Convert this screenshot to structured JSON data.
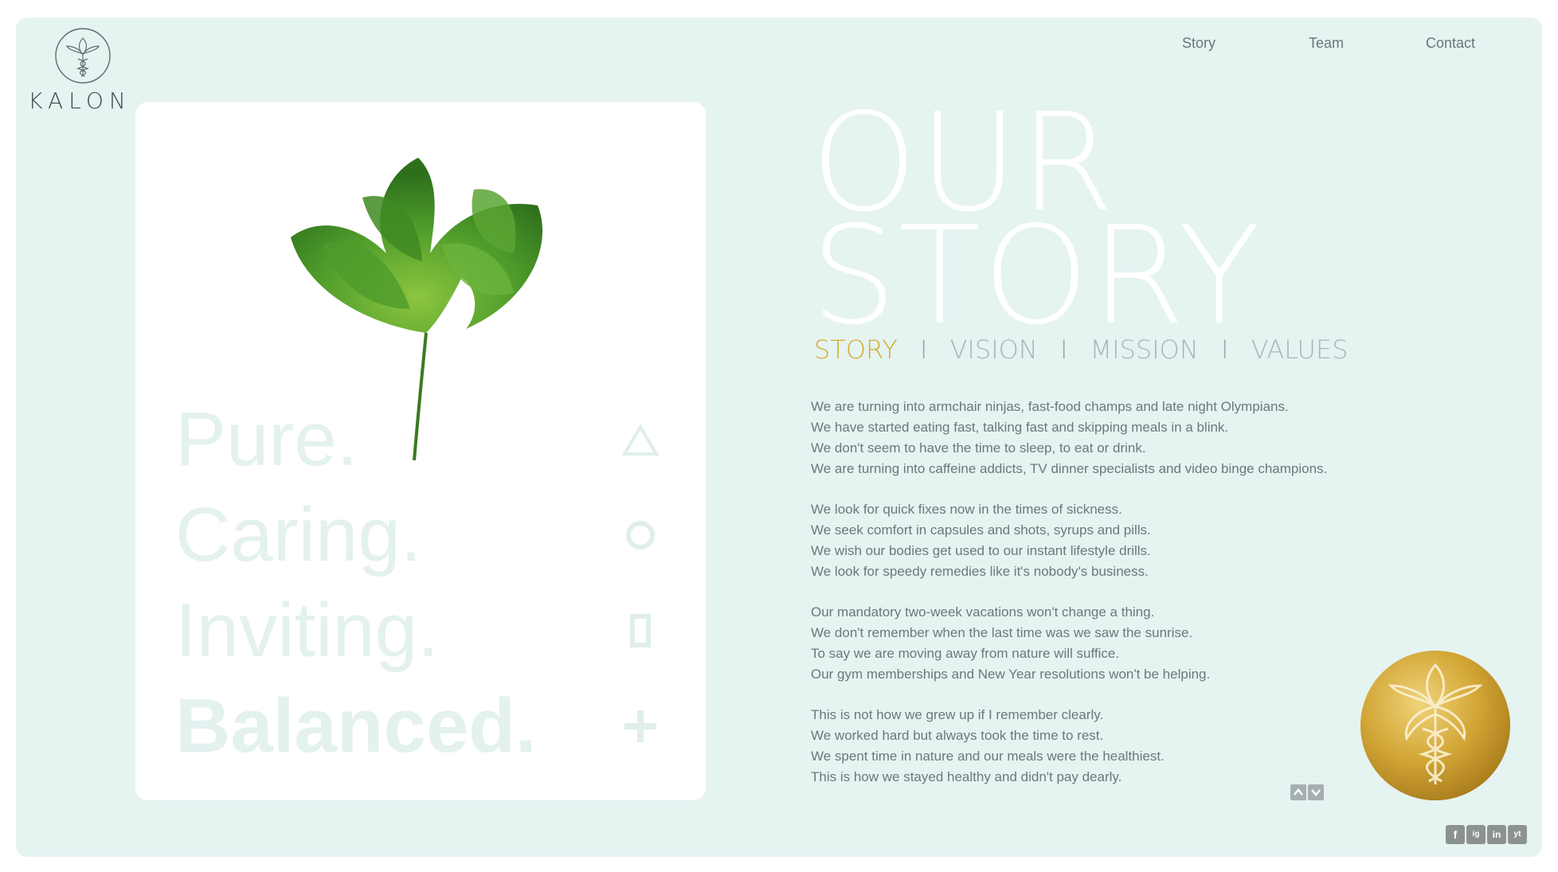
{
  "brand": {
    "name": "KALON"
  },
  "nav": {
    "items": [
      "Story",
      "Team",
      "Contact"
    ]
  },
  "card": {
    "words": [
      "Pure.",
      "Caring.",
      "Inviting.",
      "Balanced."
    ]
  },
  "hero": {
    "line1": "OUR",
    "line2": "STORY"
  },
  "tabs": {
    "items": [
      "STORY",
      "VISION",
      "MISSION",
      "VALUES"
    ],
    "active": "STORY",
    "separator": "I"
  },
  "story": {
    "paragraphs": [
      [
        "We are turning into armchair ninjas, fast-food champs and late night Olympians.",
        "We have started eating fast, talking fast and skipping meals in a blink.",
        "We don't seem to have the time to sleep, to eat or drink.",
        "We are turning into caffeine addicts, TV dinner specialists and video binge champions."
      ],
      [
        "We look for quick fixes now in the times of sickness.",
        "We seek comfort in capsules and shots, syrups and pills.",
        "We wish our bodies get used to our instant lifestyle drills.",
        "We look for speedy remedies like it's nobody's business."
      ],
      [
        "Our mandatory two-week vacations won't change a thing.",
        "We don't remember when the last time was we saw the sunrise.",
        "To say we are moving away from nature will suffice.",
        "Our gym memberships and New Year resolutions won't be helping."
      ],
      [
        "This is not how we grew up if I remember clearly.",
        "We worked hard but always took the time to rest.",
        "We spent time in nature and our meals were the healthiest.",
        "This is how we stayed healthy and didn't pay dearly."
      ]
    ]
  },
  "social": {
    "icons": [
      "facebook-icon",
      "instagram-icon",
      "linkedin-icon",
      "youtube-icon"
    ],
    "labels": [
      "f",
      "ig",
      "in",
      "yt"
    ]
  },
  "colors": {
    "background": "#e5f3f1",
    "accent": "#d4ae2d",
    "text": "#6c7979",
    "gold": "#c9a43a"
  }
}
